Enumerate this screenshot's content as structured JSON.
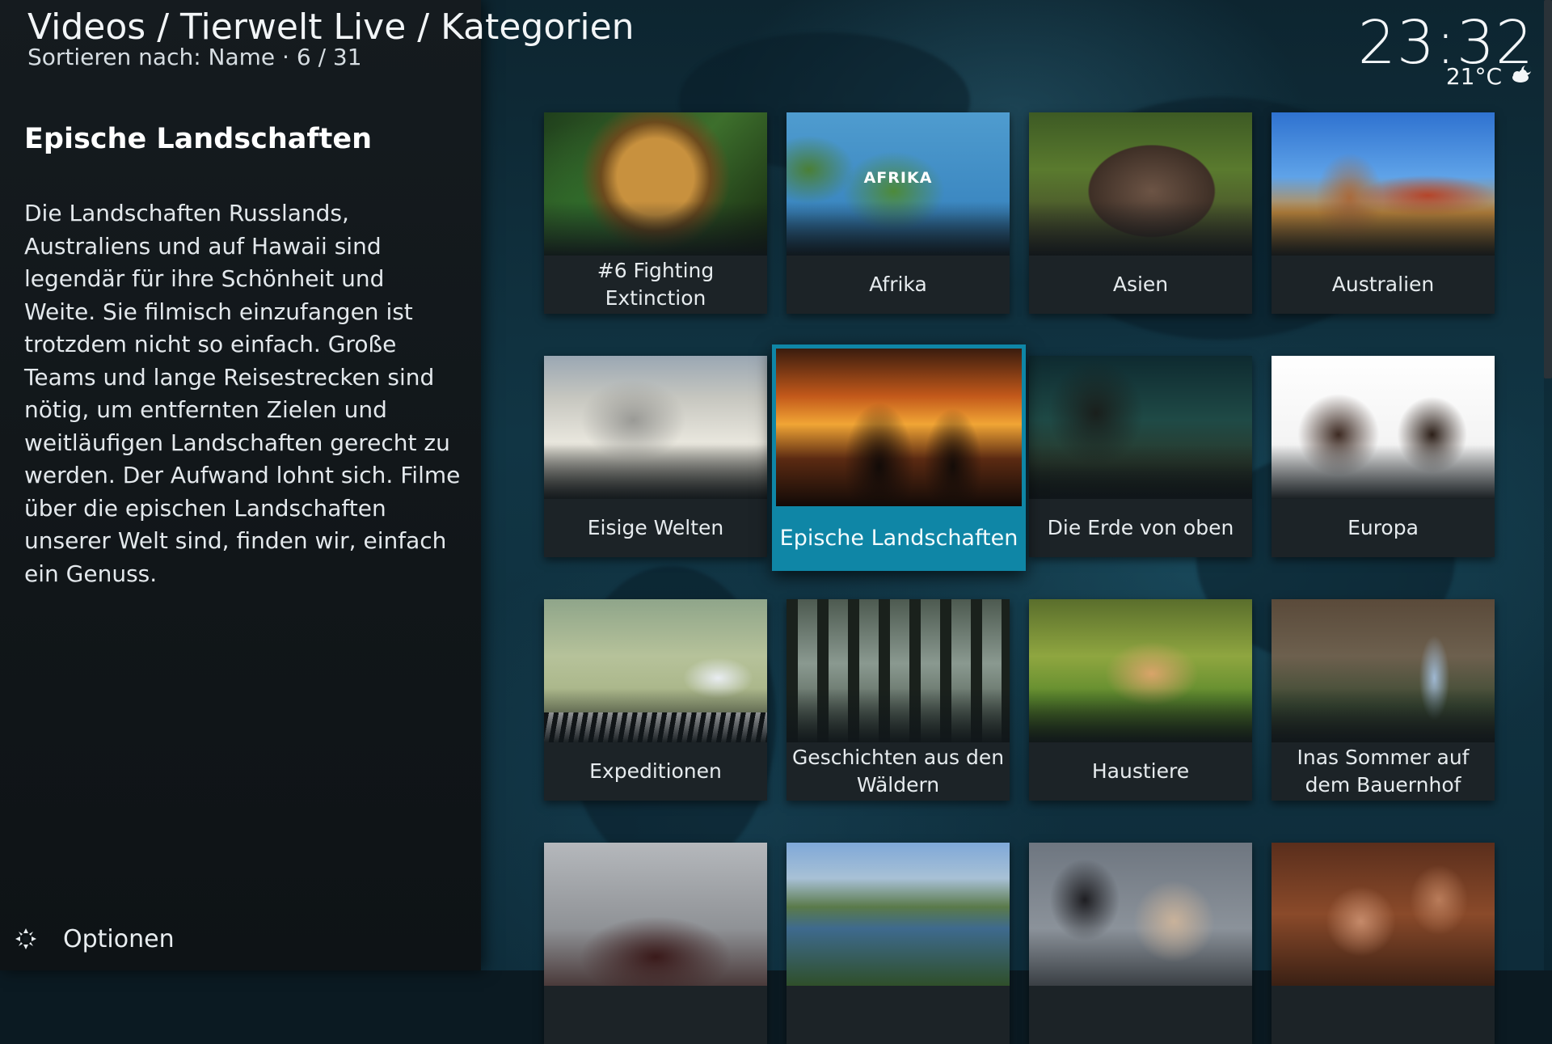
{
  "header": {
    "breadcrumb": "Videos / Tierwelt Live / Kategorien",
    "sort_info": "Sortieren nach: Name  ·  6 / 31"
  },
  "clock": {
    "time": "23:32",
    "temperature": "21°C",
    "weather_icon": "partly-cloudy-night-icon"
  },
  "info": {
    "title": "Epische Landschaften",
    "description": "Die Landschaften Russlands, Australiens und auf Hawaii sind legendär für ihre Schönheit und Weite. Sie filmisch einzufangen ist trotzdem nicht so einfach. Große Teams und lange Reisestrecken sind nötig, um entfernten Zielen und weitläufigen Landschaften gerecht zu werden. Der Aufwand lohnt sich. Filme über die epischen Landschaften unserer Welt sind, finden wir, einfach ein Genuss."
  },
  "footer": {
    "options_label": "Optionen",
    "options_icon": "gear-icon"
  },
  "grid": {
    "focused_index": 5,
    "items": [
      {
        "label": "#6 Fighting Extinction"
      },
      {
        "label": "Afrika",
        "thumb_text": "AFRIKA"
      },
      {
        "label": "Asien"
      },
      {
        "label": "Australien"
      },
      {
        "label": "Eisige Welten"
      },
      {
        "label": "Epische Landschaften"
      },
      {
        "label": "Die Erde von oben"
      },
      {
        "label": "Europa"
      },
      {
        "label": "Expeditionen"
      },
      {
        "label": "Geschichten aus den Wäldern"
      },
      {
        "label": "Haustiere"
      },
      {
        "label": "Inas Sommer auf dem Bauernhof"
      },
      {
        "label": ""
      },
      {
        "label": ""
      },
      {
        "label": ""
      },
      {
        "label": ""
      }
    ]
  },
  "colors": {
    "focus_accent": "#0f86a6",
    "panel_background": "#131a1e"
  }
}
